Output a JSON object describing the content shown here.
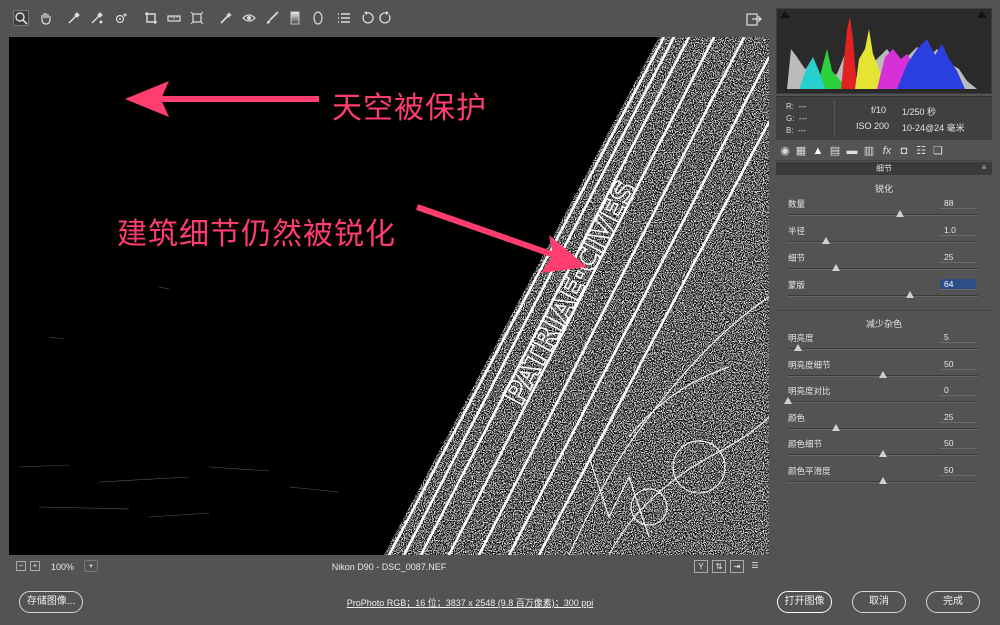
{
  "toolbar": {
    "tools": [
      "zoom-tool",
      "hand-tool",
      "white-balance-tool",
      "color-sampler-tool",
      "targeted-adjustment-tool",
      "crop-tool",
      "straighten-tool",
      "transform-tool",
      "spot-removal-tool",
      "red-eye-removal-tool",
      "adjustment-brush-tool",
      "graduated-filter-tool",
      "radial-filter-tool",
      "preferences-tool",
      "rotate-left-tool",
      "rotate-right-tool"
    ]
  },
  "preview": {
    "annotation_sky": "天空被保护",
    "annotation_building": "建筑细节仍然被锐化",
    "annotation_color": "#ff3d6e"
  },
  "status": {
    "zoom": "100%",
    "zoom_dropdown": "▾",
    "filename": "Nikon D90 -  DSC_0087.NEF",
    "zoom_out": "−",
    "zoom_in": "+",
    "view_y": "Y"
  },
  "info": {
    "r_label": "R:",
    "r_value": "---",
    "g_label": "G:",
    "g_value": "---",
    "b_label": "B:",
    "b_value": "---",
    "aperture": "f/10",
    "shutter": "1/250 秒",
    "iso": "ISO 200",
    "lens": "10-24@24 毫米"
  },
  "panel": {
    "section_title": "细节",
    "menu_icon": "≡",
    "sharpening_title": "锐化",
    "noise_title": "减少杂色",
    "sharpening": [
      {
        "label": "数量",
        "value": "88",
        "fraction": 0.59
      },
      {
        "label": "半径",
        "value": "1.0",
        "fraction": 0.2
      },
      {
        "label": "细节",
        "value": "25",
        "fraction": 0.25
      },
      {
        "label": "蒙版",
        "value": "64",
        "fraction": 0.64,
        "selected": true
      }
    ],
    "noise": [
      {
        "label": "明亮度",
        "value": "5",
        "fraction": 0.05
      },
      {
        "label": "明亮度细节",
        "value": "50",
        "fraction": 0.5
      },
      {
        "label": "明亮度对比",
        "value": "0",
        "fraction": 0.0
      },
      {
        "label": "颜色",
        "value": "25",
        "fraction": 0.25
      },
      {
        "label": "颜色细节",
        "value": "50",
        "fraction": 0.5
      },
      {
        "label": "颜色平滑度",
        "value": "50",
        "fraction": 0.5
      }
    ]
  },
  "bottom": {
    "save_label": "存储图像...",
    "workflow_label": "ProPhoto RGB；16 位；3837 x 2548 (9.8 百万像素)；300 ppi",
    "open_label": "打开图像",
    "cancel_label": "取消",
    "done_label": "完成"
  }
}
